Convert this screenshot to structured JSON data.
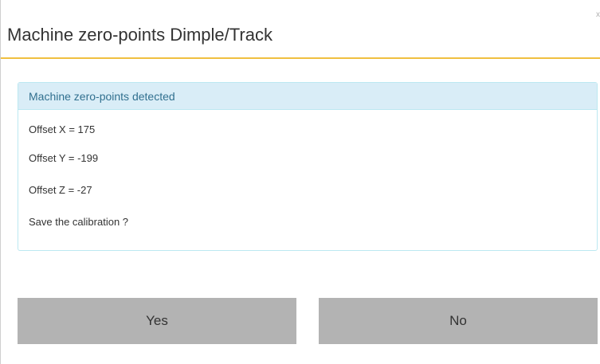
{
  "dialog": {
    "title": "Machine zero-points Dimple/Track",
    "close_glyph": "x"
  },
  "panel": {
    "heading": "Machine zero-points detected",
    "lines": [
      "Offset X = 175",
      "Offset Y = -199",
      "Offset Z = -27",
      "Save the calibration ?"
    ]
  },
  "buttons": {
    "yes_label": "Yes",
    "no_label": "No"
  },
  "colors": {
    "header_underline": "#f0c040",
    "panel_heading_bg": "#d9edf7",
    "panel_heading_text": "#31708f",
    "panel_border": "#bce8f1",
    "button_bg": "#b3b3b3"
  }
}
